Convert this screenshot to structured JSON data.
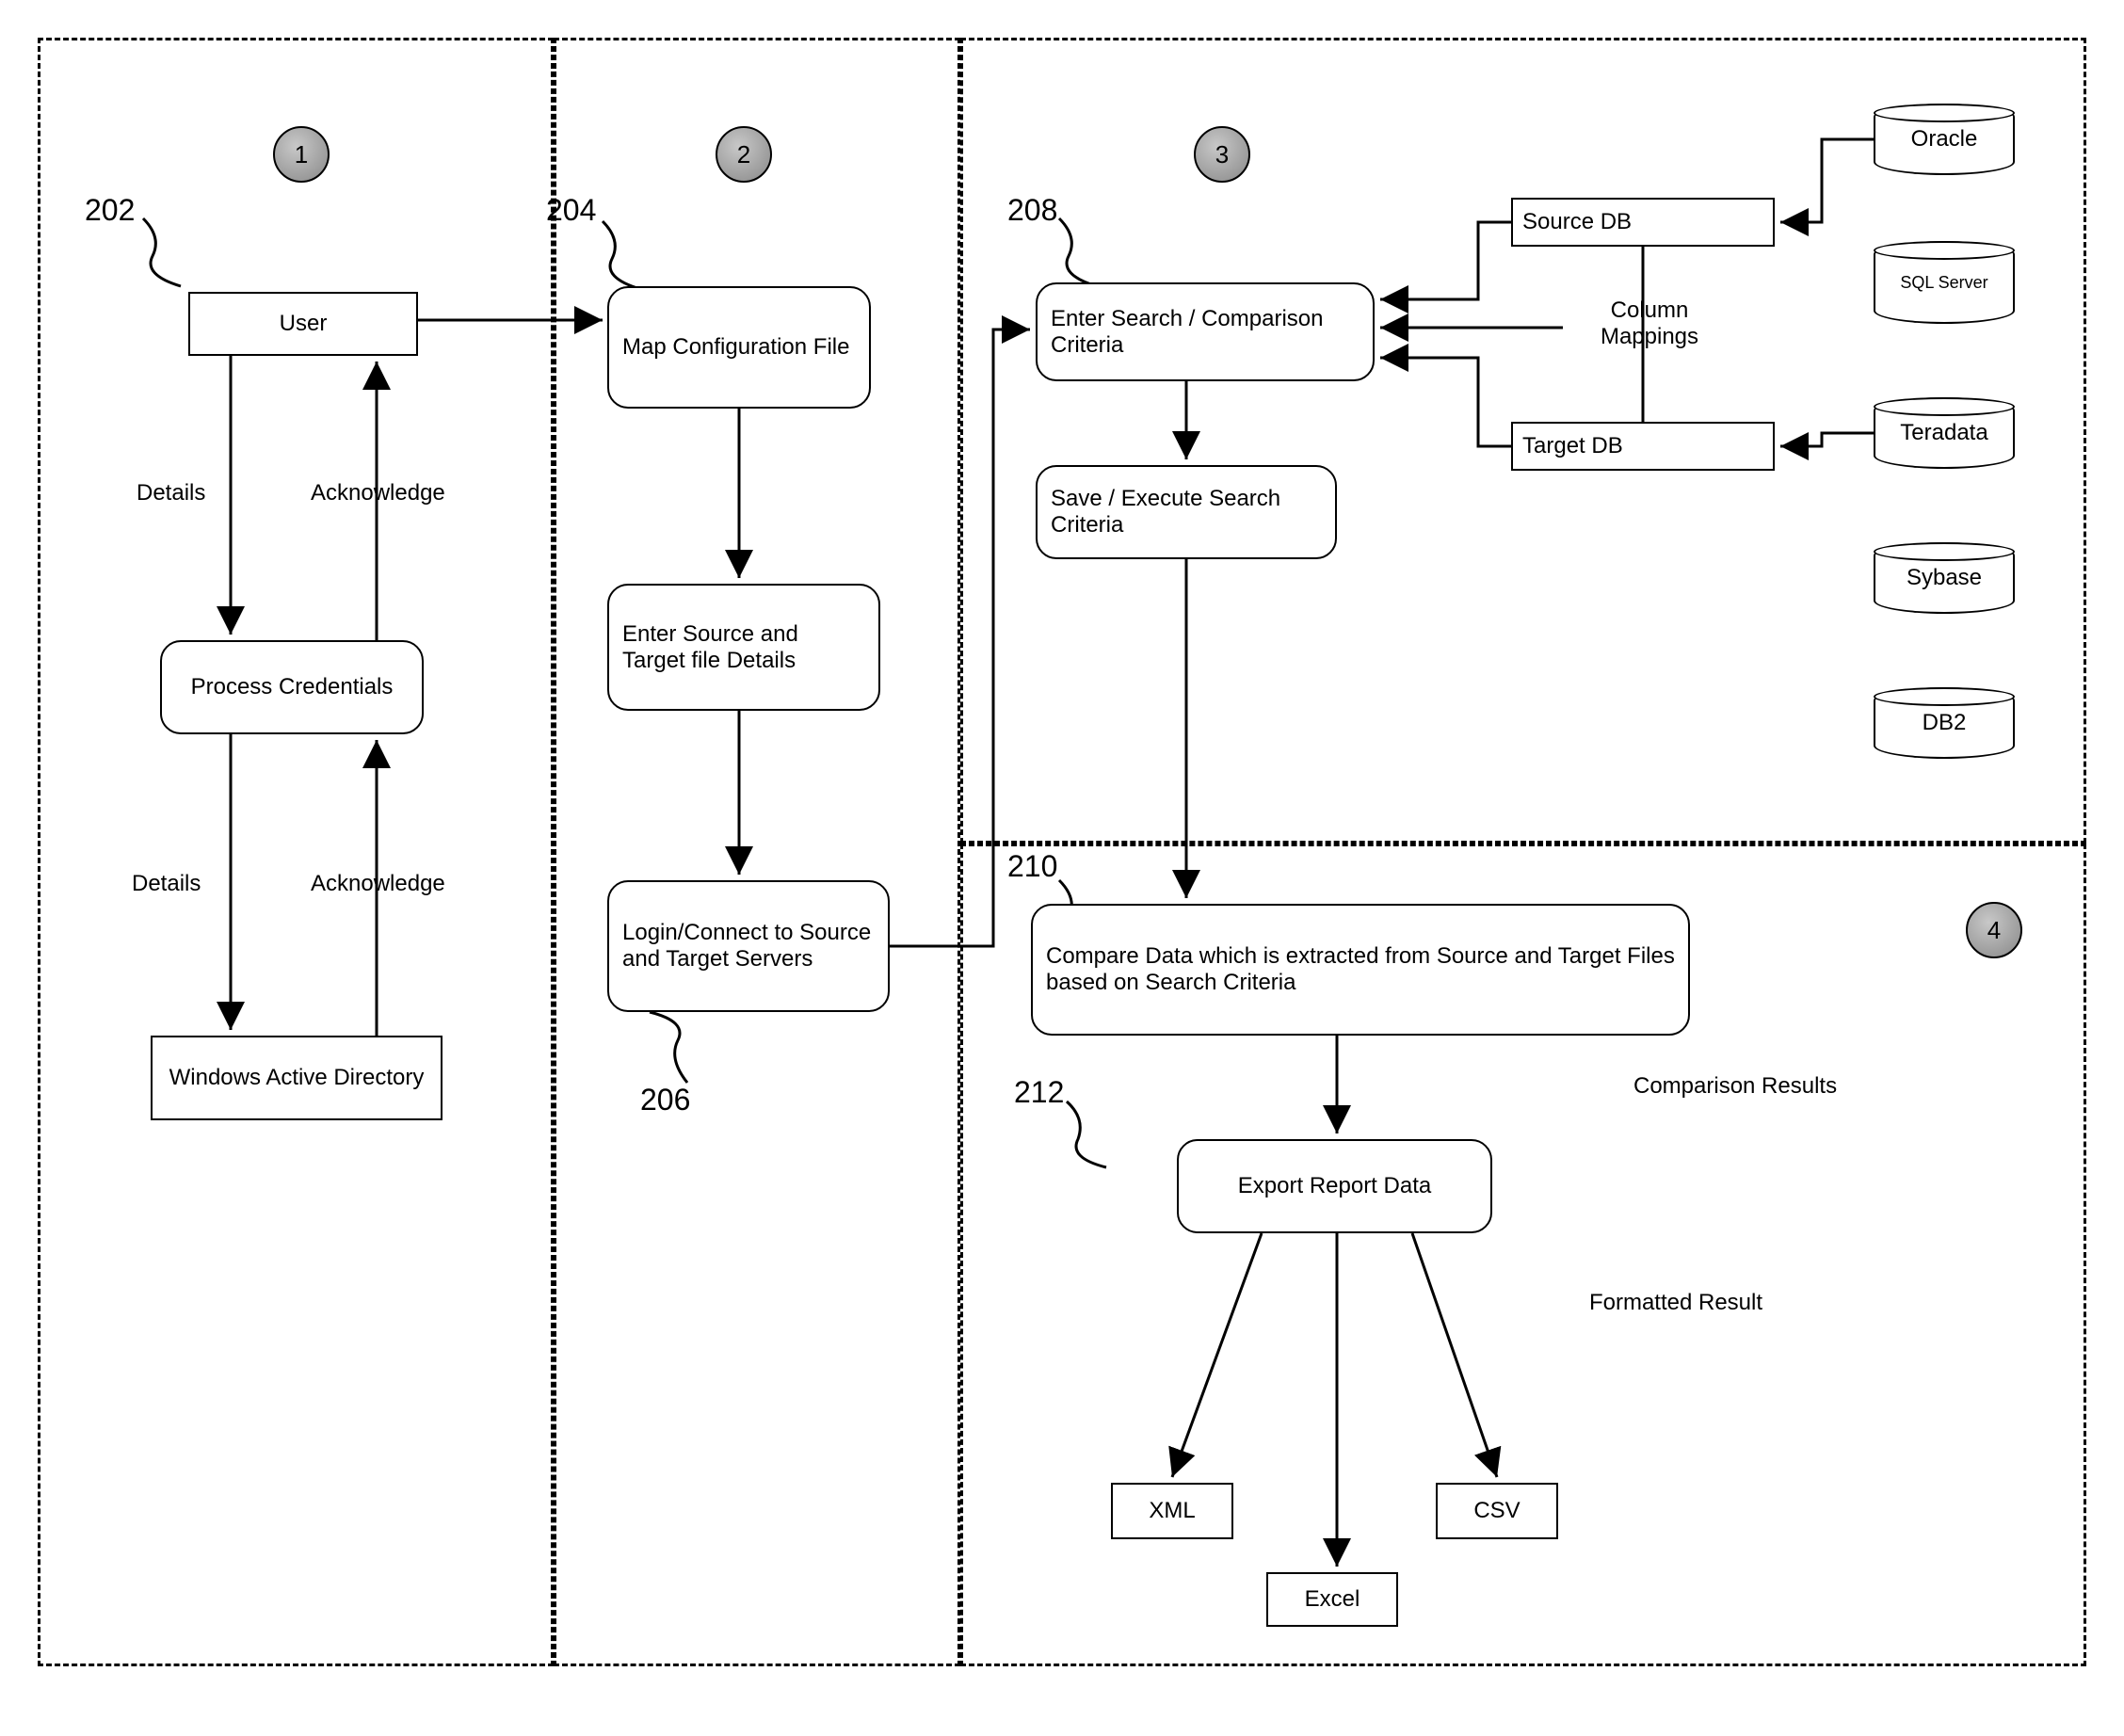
{
  "panels": {
    "p1": "1",
    "p2": "2",
    "p3": "3",
    "p4": "4"
  },
  "refs": {
    "n202": "202",
    "n204": "204",
    "n206": "206",
    "n208": "208",
    "n210": "210",
    "n212": "212"
  },
  "col1": {
    "user": "User",
    "process": "Process Credentials",
    "wad": "Windows Active Directory",
    "details": "Details",
    "ack": "Acknowledge"
  },
  "col2": {
    "map": "Map Configuration File",
    "enter": "Enter Source and Target file Details",
    "login": "Login/Connect to Source and Target Servers"
  },
  "col3": {
    "search": "Enter Search / Comparison Criteria",
    "save": "Save / Execute Search Criteria",
    "srcdb": "Source DB",
    "tgtdb": "Target DB",
    "colmap": "Column Mappings"
  },
  "dbs": {
    "oracle": "Oracle",
    "sql": "SQL Server",
    "teradata": "Teradata",
    "sybase": "Sybase",
    "db2": "DB2"
  },
  "col4": {
    "compare": "Compare Data which is extracted from Source and Target Files based on Search Criteria",
    "export": "Export Report Data",
    "compres": "Comparison Results",
    "fmtres": "Formatted Result",
    "xml": "XML",
    "excel": "Excel",
    "csv": "CSV"
  }
}
